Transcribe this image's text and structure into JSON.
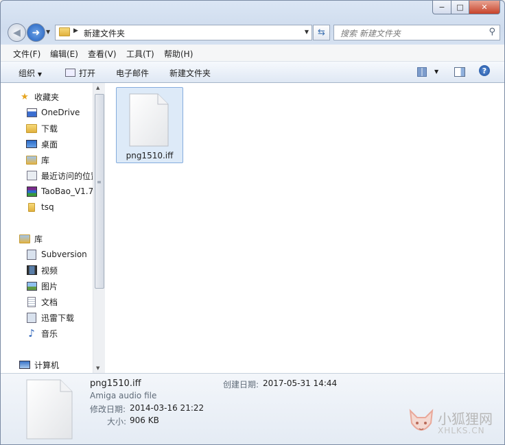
{
  "window": {
    "caption_buttons": {
      "minimize": "−",
      "maximize": "□",
      "close": "✕"
    }
  },
  "address": {
    "crumb": "新建文件夹",
    "search_placeholder": "搜索 新建文件夹"
  },
  "menubar": {
    "items": [
      "文件(F)",
      "编辑(E)",
      "查看(V)",
      "工具(T)",
      "帮助(H)"
    ]
  },
  "toolbar": {
    "organize": "组织",
    "open": "打开",
    "email": "电子邮件",
    "new_folder": "新建文件夹"
  },
  "nav": {
    "favorites": {
      "label": "收藏夹",
      "items": [
        "OneDrive",
        "下载",
        "桌面",
        "库",
        "最近访问的位置",
        "TaoBao_V1.7",
        "tsq"
      ]
    },
    "libraries": {
      "label": "库",
      "items": [
        "Subversion",
        "视频",
        "图片",
        "文档",
        "迅雷下载",
        "音乐"
      ]
    },
    "computer": {
      "label": "计算机"
    }
  },
  "files": [
    {
      "name": "png1510.iff",
      "selected": true
    }
  ],
  "details": {
    "filename": "png1510.iff",
    "type": "Amiga audio file",
    "modified_label": "修改日期:",
    "modified": "2014-03-16 21:22",
    "size_label": "大小:",
    "size": "906 KB",
    "created_label": "创建日期:",
    "created": "2017-05-31 14:44"
  },
  "watermark": {
    "cn": "小狐狸网",
    "en": "XHLKS.CN"
  },
  "colors": {
    "accent": "#1f5fbf",
    "selection": "#ddeaf8",
    "selection_border": "#84acdd"
  }
}
